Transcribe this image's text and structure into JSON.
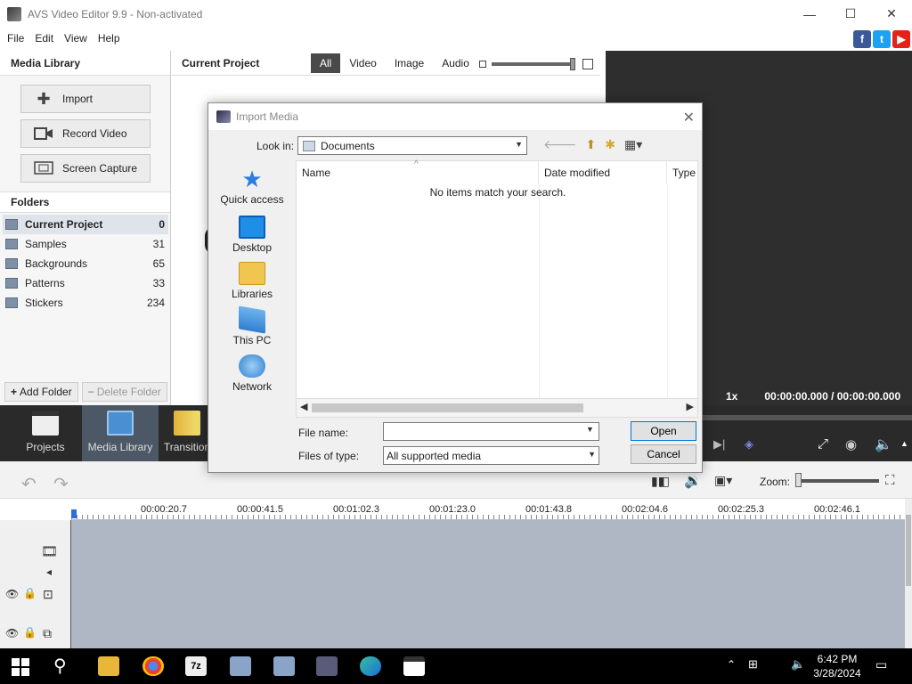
{
  "window": {
    "title": "AVS Video Editor 9.9 - Non-activated",
    "minimize": "—",
    "maximize": "☐",
    "close": "✕"
  },
  "menu": [
    "File",
    "Edit",
    "View",
    "Help"
  ],
  "social": [
    "f",
    "t",
    "▶"
  ],
  "media_library": {
    "title": "Media Library",
    "import_label": "Import",
    "record_label": "Record Video",
    "capture_label": "Screen Capture",
    "folders_title": "Folders",
    "folders": [
      {
        "name": "Current Project",
        "count": "0"
      },
      {
        "name": "Samples",
        "count": "31"
      },
      {
        "name": "Backgrounds",
        "count": "65"
      },
      {
        "name": "Patterns",
        "count": "33"
      },
      {
        "name": "Stickers",
        "count": "234"
      }
    ],
    "add_folder": "Add Folder",
    "delete_folder": "Delete Folder"
  },
  "current_project": {
    "title": "Current Project",
    "filters": [
      "All",
      "Video",
      "Image",
      "Audio"
    ]
  },
  "preview": {
    "speed": "1x",
    "time": "00:00:00.000 / 00:00:00.000"
  },
  "toolbar": {
    "projects": "Projects",
    "media_library": "Media Library",
    "transitions": "Transition"
  },
  "timeline": {
    "zoom_label": "Zoom:",
    "ruler": [
      "00:00:20.7",
      "00:00:41.5",
      "00:01:02.3",
      "00:01:23.0",
      "00:01:43.8",
      "00:02:04.6",
      "00:02:25.3",
      "00:02:46.1"
    ]
  },
  "dialog": {
    "title": "Import Media",
    "look_in_label": "Look in:",
    "look_in_value": "Documents",
    "places": [
      "Quick access",
      "Desktop",
      "Libraries",
      "This PC",
      "Network"
    ],
    "columns": [
      "Name",
      "Date modified",
      "Type"
    ],
    "empty_message": "No items match your search.",
    "file_name_label": "File name:",
    "file_name_value": "",
    "file_type_label": "Files of type:",
    "file_type_value": "All supported media",
    "open_label": "Open",
    "cancel_label": "Cancel"
  },
  "taskbar": {
    "time": "6:42 PM",
    "date": "3/28/2024"
  }
}
